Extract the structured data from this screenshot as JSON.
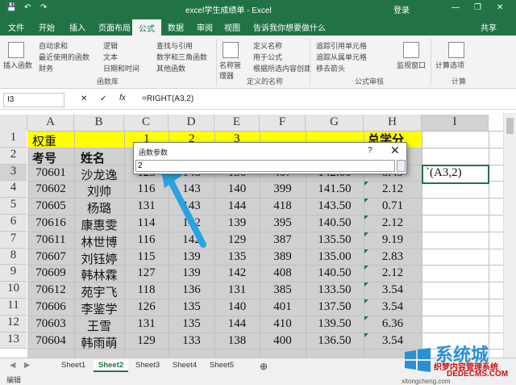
{
  "titlebar": {
    "filename": "excel学生成绩单 - Excel",
    "login": "登录",
    "minimize": "—",
    "restore": "❐",
    "close": "✕"
  },
  "tabs": [
    "文件",
    "开始",
    "插入",
    "页面布局",
    "公式",
    "数据",
    "审阅",
    "视图"
  ],
  "tell_me": "告诉我你想要做什么",
  "share": "共享",
  "ribbon": {
    "insert_function": "插入函数",
    "autosum": "自动求和",
    "recent": "最近使用的函数",
    "financial": "财务",
    "logical": "逻辑",
    "text": "文本",
    "datetime": "日期和时间",
    "lookup": "查找与引用",
    "math": "数学和三角函数",
    "other": "其他函数",
    "group_library": "函数库",
    "name_manager": "名称管理器",
    "define_name": "定义名称",
    "use_in_formula": "用于公式",
    "create_from_sel": "根据所选内容创建",
    "group_defined": "定义的名称",
    "trace_prec": "追踪引用单元格",
    "trace_dep": "追踪从属单元格",
    "remove_arrows": "移去箭头",
    "watch": "监视窗口",
    "group_audit": "公式审核",
    "calc_options": "计算选项",
    "group_calc": "计算"
  },
  "formula_bar": {
    "name_box": "I3",
    "cancel": "✕",
    "enter": "✓",
    "fx": "fx",
    "formula": "=RIGHT(A3,2)"
  },
  "columns": [
    "A",
    "B",
    "C",
    "D",
    "E",
    "F",
    "G",
    "H",
    "I"
  ],
  "rows": [
    "1",
    "2",
    "3",
    "4",
    "5",
    "6",
    "7",
    "8",
    "9",
    "10",
    "11",
    "12",
    "13"
  ],
  "row1": {
    "a": "权重",
    "c": "1",
    "d": "2",
    "e": "3",
    "h": "总学分"
  },
  "row2": {
    "a": "考号",
    "b": "姓名",
    "h": "学"
  },
  "data_rows": [
    [
      "70601",
      "沙龙逸",
      "123",
      "148",
      "136",
      "407",
      "142.00",
      "8.49"
    ],
    [
      "70602",
      "刘帅",
      "116",
      "143",
      "140",
      "399",
      "141.50",
      "2.12"
    ],
    [
      "70605",
      "杨璐",
      "131",
      "143",
      "144",
      "418",
      "143.50",
      "0.71"
    ],
    [
      "70616",
      "康惠雯",
      "114",
      "142",
      "139",
      "395",
      "140.50",
      "2.12"
    ],
    [
      "70611",
      "林世博",
      "116",
      "142",
      "129",
      "387",
      "135.50",
      "9.19"
    ],
    [
      "70607",
      "刘钰婷",
      "115",
      "139",
      "135",
      "389",
      "135.00",
      "2.83"
    ],
    [
      "70609",
      "韩林霖",
      "127",
      "139",
      "142",
      "408",
      "140.50",
      "2.12"
    ],
    [
      "70612",
      "苑宇飞",
      "118",
      "136",
      "131",
      "385",
      "133.50",
      "3.54"
    ],
    [
      "70606",
      "李鉴学",
      "126",
      "135",
      "140",
      "401",
      "137.50",
      "3.54"
    ],
    [
      "70603",
      "王雪",
      "131",
      "135",
      "144",
      "410",
      "139.50",
      "6.36"
    ],
    [
      "70604",
      "韩雨萌",
      "129",
      "133",
      "138",
      "400",
      "136.50",
      "3.54"
    ]
  ],
  "i3_text": "`(A3,2)",
  "dialog": {
    "title": "函数参数",
    "help": "?",
    "close": "✕",
    "value": "2"
  },
  "sheets": [
    "Sheet1",
    "Sheet2",
    "Sheet3",
    "Sheet4",
    "Sheet5"
  ],
  "active_sheet": "Sheet2",
  "status": "编辑",
  "watermark": {
    "main": "系统城",
    "site": "织梦内容管理系统",
    "url": "DEDECMS.COM",
    "sub": "xitongcheng.com"
  },
  "colors": {
    "excel_green": "#217346",
    "yellow": "#ffff00",
    "arrow": "#29a3e0"
  }
}
